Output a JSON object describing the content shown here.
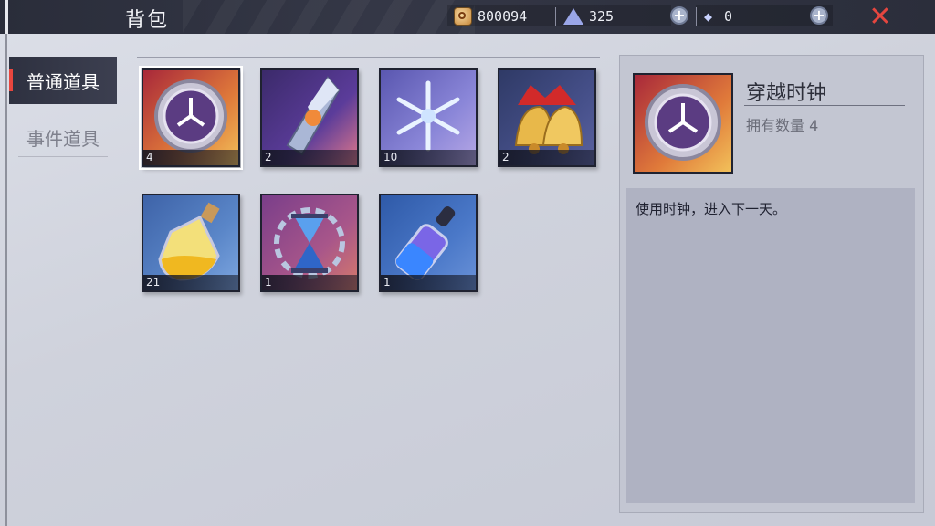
{
  "header": {
    "title": "背包",
    "gold": "800094",
    "crystal": "325",
    "diamond": "0",
    "close_icon": "close-icon"
  },
  "tabs": [
    {
      "label": "普通道具",
      "active": true
    },
    {
      "label": "事件道具",
      "active": false
    }
  ],
  "items": [
    {
      "icon": "clock-icon",
      "count": "4",
      "selected": true
    },
    {
      "icon": "crystal-shard-icon",
      "count": "2"
    },
    {
      "icon": "snowflake-icon",
      "count": "10"
    },
    {
      "icon": "bells-icon",
      "count": "2"
    },
    {
      "icon": "potion-bottle-icon",
      "count": "21"
    },
    {
      "icon": "hourglass-icon",
      "count": "1"
    },
    {
      "icon": "dropper-vial-icon",
      "count": "1"
    }
  ],
  "detail": {
    "name": "穿越时钟",
    "count_label": "拥有数量 4",
    "description": "使用时钟，进入下一天。"
  },
  "colors": {
    "accent_red": "#e8463e",
    "topbar": "#2f3240",
    "panel": "#c3c6d2"
  }
}
